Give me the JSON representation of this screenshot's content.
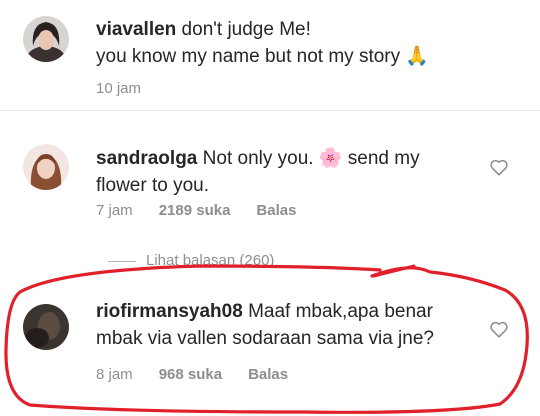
{
  "comments": [
    {
      "username": "viavallen",
      "text": " don't judge Me!",
      "text2": "you know my name but not my story ",
      "emoji": "🙏",
      "time": "10 jam"
    },
    {
      "username": "sandraolga",
      "text": " Not only you. ",
      "emoji": "🌸",
      "text2": " send my",
      "text3": "flower to you.",
      "time": "7 jam",
      "likes": "2189 suka",
      "reply": "Balas"
    },
    {
      "username": "riofirmansyah08",
      "text": " Maaf mbak,apa benar",
      "text2": "mbak via vallen sodaraan sama via jne?",
      "time": "8 jam",
      "likes": "968 suka",
      "reply": "Balas"
    }
  ],
  "view_replies": "Lihat balasan (260)",
  "colors": {
    "annotation": "#e0202a",
    "meta": "#8e8e8e",
    "text": "#262626"
  }
}
